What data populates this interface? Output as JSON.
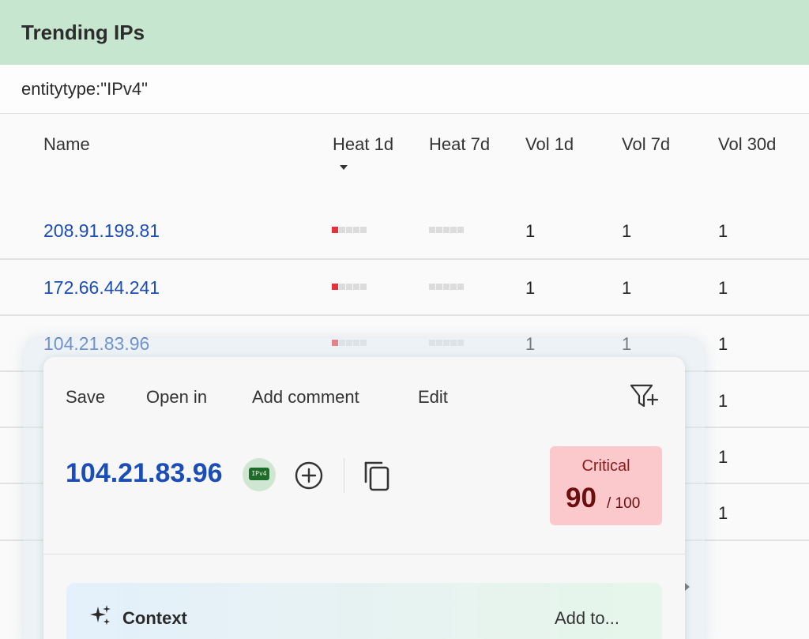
{
  "header": {
    "title": "Trending IPs"
  },
  "query": {
    "text": "entitytype:\"IPv4\""
  },
  "table": {
    "columns": [
      "Name",
      "Heat 1d",
      "Heat 7d",
      "Vol 1d",
      "Vol 7d",
      "Vol 30d"
    ],
    "sorted_column": "Heat 1d",
    "rows": [
      {
        "name": "208.91.198.81",
        "heat_1d_level": 1,
        "heat_7d_level": 0,
        "vol_1d": "1",
        "vol_7d": "1",
        "vol_30d": "1"
      },
      {
        "name": "172.66.44.241",
        "heat_1d_level": 1,
        "heat_7d_level": 0,
        "vol_1d": "1",
        "vol_7d": "1",
        "vol_30d": "1"
      },
      {
        "name": "104.21.83.96",
        "heat_1d_level": 1,
        "heat_7d_level": 0,
        "vol_1d": "1",
        "vol_7d": "1",
        "vol_30d": "1"
      },
      {
        "name": "",
        "vol_30d": "1"
      },
      {
        "name": "",
        "vol_30d": "1"
      },
      {
        "name": "",
        "vol_30d": "1"
      }
    ]
  },
  "popup": {
    "menu": {
      "save": "Save",
      "open_in": "Open in",
      "add_comment": "Add comment",
      "edit": "Edit"
    },
    "entity": {
      "ip": "104.21.83.96",
      "type_badge": "IPv4"
    },
    "risk": {
      "label": "Critical",
      "score": "90",
      "max": "/ 100",
      "color": "#fbc9cb"
    },
    "context": {
      "label": "Context",
      "action": "Add to..."
    }
  },
  "colors": {
    "header_bg": "#c6e6cf",
    "link": "#1a4db8",
    "heat_hot": "#e8303a"
  },
  "icons": [
    "filter-add-icon",
    "plus-circle-icon",
    "copy-icon",
    "sparkle-icon",
    "chevron-right-icon",
    "sort-caret-icon"
  ]
}
